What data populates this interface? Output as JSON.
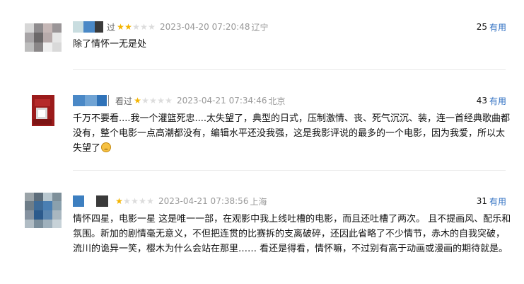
{
  "reviews": [
    {
      "username_tail": "过",
      "stars": 2,
      "time": "2023-04-20 07:20:48",
      "location": "辽宁",
      "useful_count": "25",
      "useful_label": "有用",
      "content": "除了情怀一无是处"
    },
    {
      "username_tail": "看过",
      "stars": 1,
      "time": "2023-04-21 07:34:46",
      "location": "北京",
      "useful_count": "43",
      "useful_label": "有用",
      "content": "千万不要看....我一个灌篮死忠....太失望了，典型的日式，压制激情、丧、死气沉沉、装，连一首经典歌曲都没有，整个电影一点高潮都没有，编辑水平还没我强，这是我影评说的最多的一个电影，因为我爱，所以太失望了",
      "emoji": "sad-face"
    },
    {
      "username_tail": "",
      "stars": 1,
      "time": "2023-04-21 07:38:56",
      "location": "上海",
      "useful_count": "31",
      "useful_label": "有用",
      "content": "情怀四星，电影一星 这是唯一一部，在观影中我上线吐槽的电影，而且还吐槽了两次。 且不提画风、配乐和氛围。新加的剧情毫无意义，不但把连贯的比赛拆的支离破碎，还因此省略了不少情节，赤木的自我突破，流川的诡异一笑，樱木为什么会站在那里…… 看还是得看，情怀嘛，不过别有高于动画或漫画的期待就是。"
    }
  ],
  "colors": {
    "star_on": "#f4b400",
    "star_off": "#dcdcdc",
    "link": "#2f6fc2"
  }
}
